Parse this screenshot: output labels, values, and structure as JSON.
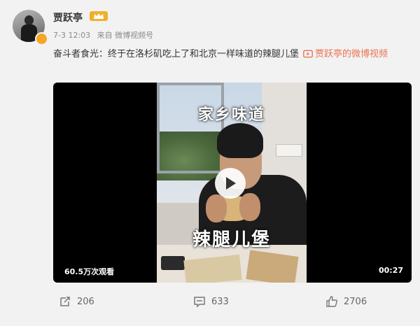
{
  "header": {
    "username": "贾跃亭",
    "meta": {
      "time": "7-3 12:03",
      "source": "来自 微博视频号"
    }
  },
  "post": {
    "text": "奋斗者食光：终于在洛杉矶吃上了和北京一样味道的辣腿儿堡",
    "link_label": "贾跃亭的微博视频"
  },
  "video": {
    "caption_top": "家乡味道",
    "caption_bottom": "辣腿儿堡",
    "views": "60.5万次观看",
    "duration": "00:27"
  },
  "actions": {
    "repost_count": "206",
    "comment_count": "633",
    "like_count": "2706"
  },
  "colors": {
    "background": "#f2f2f2",
    "link": "#eb7350",
    "verified": "#f5a623",
    "vip": "#f0b02a"
  },
  "icons": [
    "verified-icon",
    "vip-crown-icon",
    "video-link-icon",
    "play-icon",
    "repost-icon",
    "comment-icon",
    "like-icon"
  ]
}
